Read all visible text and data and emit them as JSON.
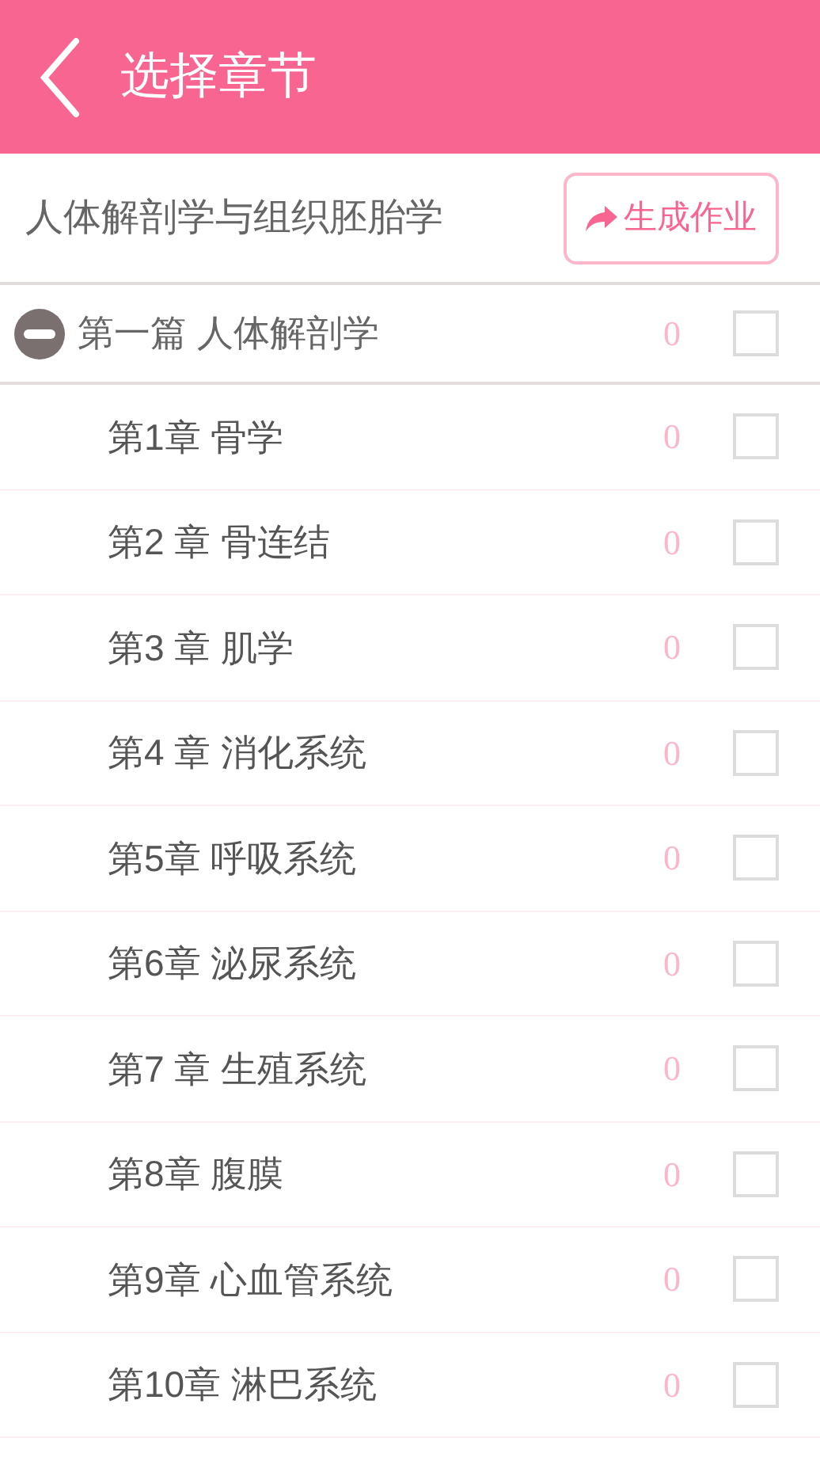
{
  "header": {
    "title": "选择章节"
  },
  "subject": {
    "title": "人体解剖学与组织胚胎学",
    "action": "生成作业"
  },
  "parts": [
    {
      "title": "第一篇 人体解剖学",
      "count": "0",
      "checked": false,
      "expanded": true,
      "children": [
        {
          "title": "第1章 骨学",
          "count": "0",
          "checked": false
        },
        {
          "title": "第2 章 骨连结",
          "count": "0",
          "checked": false
        },
        {
          "title": "第3 章 肌学",
          "count": "0",
          "checked": false
        },
        {
          "title": "第4 章 消化系统",
          "count": "0",
          "checked": false
        },
        {
          "title": "第5章 呼吸系统",
          "count": "0",
          "checked": false
        },
        {
          "title": "第6章 泌尿系统",
          "count": "0",
          "checked": false
        },
        {
          "title": "第7 章 生殖系统",
          "count": "0",
          "checked": false
        },
        {
          "title": "第8章 腹膜",
          "count": "0",
          "checked": false
        },
        {
          "title": "第9章 心血管系统",
          "count": "0",
          "checked": false
        },
        {
          "title": "第10章 淋巴系统",
          "count": "0",
          "checked": false
        }
      ]
    }
  ]
}
